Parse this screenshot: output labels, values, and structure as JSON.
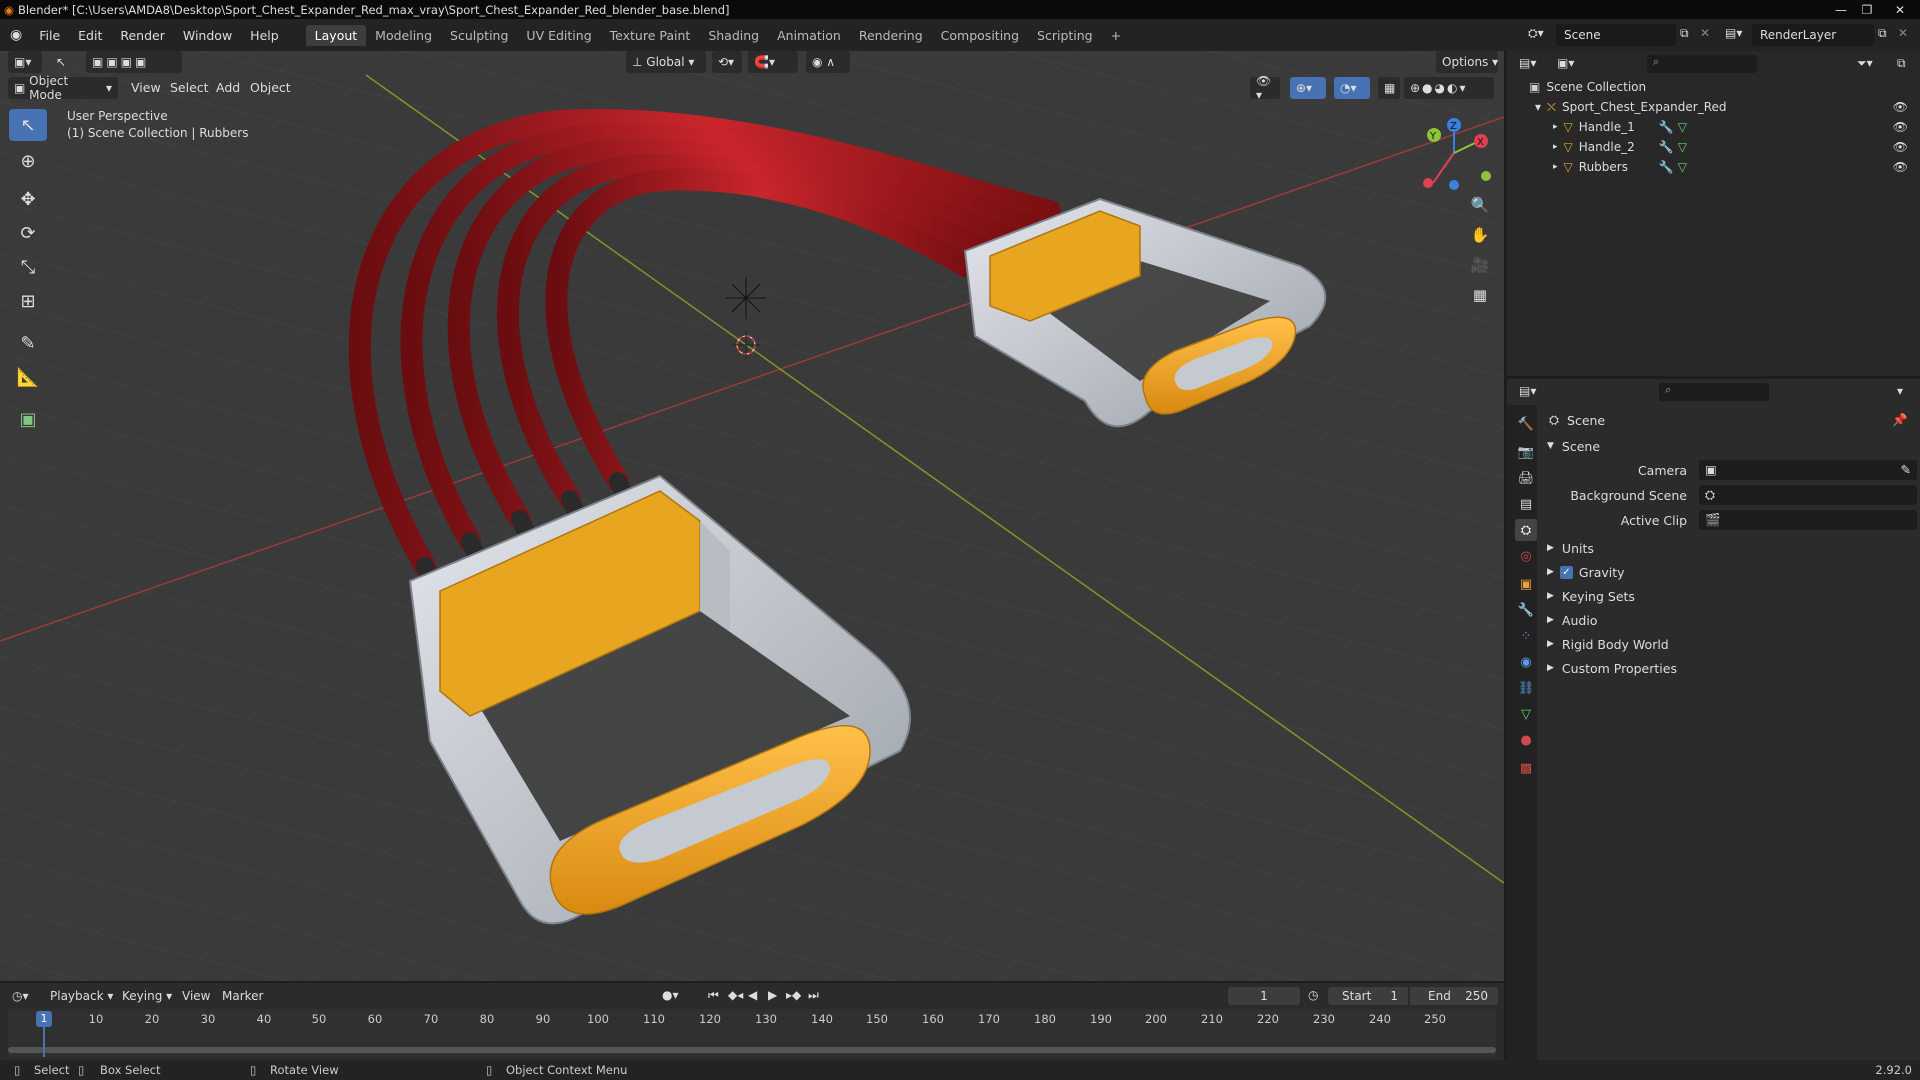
{
  "window": {
    "title": "Blender* [C:\\Users\\AMDA8\\Desktop\\Sport_Chest_Expander_Red_max_vray\\Sport_Chest_Expander_Red_blender_base.blend]",
    "controls": [
      "—",
      "❐",
      "✕"
    ]
  },
  "menu": [
    "File",
    "Edit",
    "Render",
    "Window",
    "Help"
  ],
  "workspaces": [
    "Layout",
    "Modeling",
    "Sculpting",
    "UV Editing",
    "Texture Paint",
    "Shading",
    "Animation",
    "Rendering",
    "Compositing",
    "Scripting"
  ],
  "active_workspace": "Layout",
  "add_workspace": "+",
  "scene_selector": "Scene",
  "view_layer": "RenderLayer",
  "viewport": {
    "mode": "Object Mode",
    "menus": [
      "View",
      "Select",
      "Add",
      "Object"
    ],
    "orientation": "Global",
    "options": "Options",
    "overlay_line1": "User Perspective",
    "overlay_line2": "(1) Scene Collection | Rubbers",
    "gizmo_labels": {
      "x": "X",
      "y": "Y",
      "z": "Z"
    },
    "colors": {
      "rubber": "#b01a1f",
      "handle_grip": "#f0a020",
      "frame": "#c8ccd2",
      "grid_x": "#9b3a3a",
      "grid_y": "#7a9b2a"
    }
  },
  "outliner": {
    "root": "Scene Collection",
    "collection": "Sport_Chest_Expander_Red",
    "objects": [
      "Handle_1",
      "Handle_2",
      "Rubbers"
    ]
  },
  "properties": {
    "header": "Scene",
    "panel": "Scene",
    "fields": [
      {
        "label": "Camera"
      },
      {
        "label": "Background Scene"
      },
      {
        "label": "Active Clip"
      }
    ],
    "sections": [
      "Units",
      "Gravity",
      "Keying Sets",
      "Audio",
      "Rigid Body World",
      "Custom Properties"
    ],
    "gravity_checked": true
  },
  "timeline": {
    "menus": [
      "Playback",
      "Keying",
      "View",
      "Marker"
    ],
    "current_frame": "1",
    "start_label": "Start",
    "start": "1",
    "end_label": "End",
    "end": "250",
    "ticks": [
      "1",
      "10",
      "20",
      "30",
      "40",
      "50",
      "60",
      "70",
      "80",
      "90",
      "100",
      "110",
      "120",
      "130",
      "140",
      "150",
      "160",
      "170",
      "180",
      "190",
      "200",
      "210",
      "220",
      "230",
      "240",
      "250"
    ]
  },
  "status": {
    "select": "Select",
    "box_select": "Box Select",
    "rotate": "Rotate View",
    "context": "Object Context Menu",
    "version": "2.92.0"
  }
}
